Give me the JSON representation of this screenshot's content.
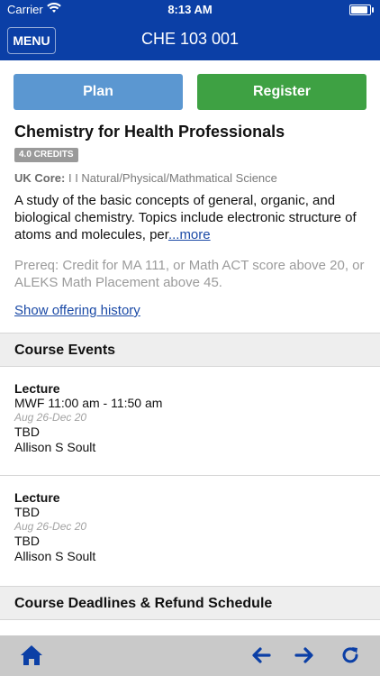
{
  "status": {
    "carrier": "Carrier",
    "time": "8:13 AM"
  },
  "nav": {
    "menu_label": "MENU",
    "title": "CHE 103 001"
  },
  "actions": {
    "plan_label": "Plan",
    "register_label": "Register"
  },
  "course": {
    "title": "Chemistry for Health Professionals",
    "credits": "4.0 CREDITS",
    "uk_core_label": "UK Core:",
    "uk_core_value": "I I Natural/Physical/Mathmatical Science",
    "description": "A study of the basic concepts of general, organic, and biological chemistry. Topics include electronic structure of atoms and molecules, per",
    "more_link": "...more",
    "prereq": "Prereq: Credit for MA 111, or Math ACT score above 20, or ALEKS Math Placement above 45.",
    "history_link": "Show offering history"
  },
  "sections": {
    "events_header": "Course Events",
    "deadlines_header": "Course Deadlines & Refund Schedule"
  },
  "events": [
    {
      "type": "Lecture",
      "time": "MWF 11:00 am - 11:50 am",
      "dates": "Aug 26-Dec 20",
      "location": "TBD",
      "instructor": "Allison S Soult"
    },
    {
      "type": "Lecture",
      "time": "TBD",
      "dates": "Aug 26-Dec 20",
      "location": "TBD",
      "instructor": "Allison S Soult"
    }
  ],
  "toolbar": {
    "icons": [
      "home-icon",
      "back-arrow-icon",
      "forward-arrow-icon",
      "refresh-icon"
    ]
  }
}
